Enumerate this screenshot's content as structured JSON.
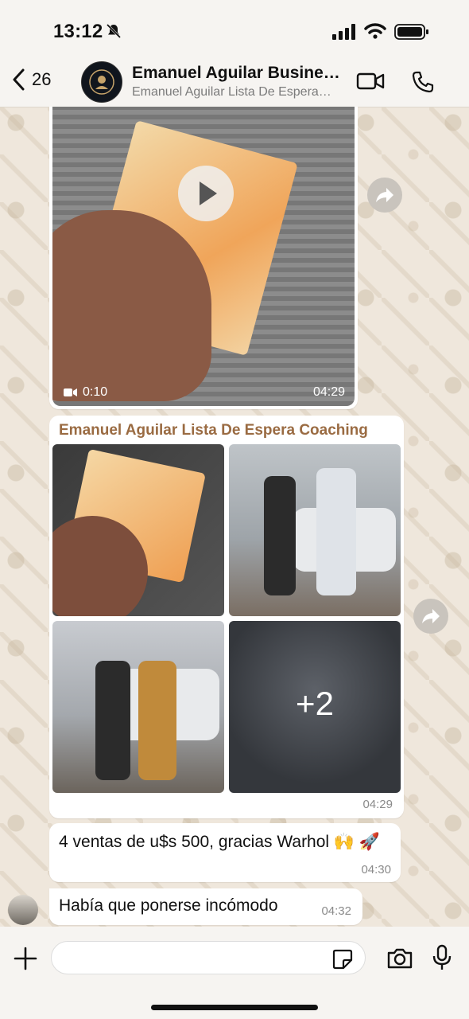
{
  "status_bar": {
    "time": "13:12"
  },
  "header": {
    "back_count": "26",
    "title": "Emanuel Aguilar Busine…",
    "subtitle": "Emanuel Aguilar Lista De Espera…"
  },
  "messages": {
    "video": {
      "duration": "0:10",
      "time": "04:29"
    },
    "album": {
      "sender": "Emanuel Aguilar Lista De Espera Coaching",
      "more_count": "+2",
      "time": "04:29"
    },
    "text": {
      "body": "4 ventas de u$s 500, gracias Warhol 🙌 🚀",
      "time": "04:30"
    },
    "reply": {
      "body": "Había que ponerse incómodo",
      "time": "04:32"
    }
  },
  "composer": {
    "placeholder": ""
  },
  "icons": {
    "back": "chevron-left-icon",
    "video_call": "video-camera-icon",
    "call": "phone-icon",
    "forward": "forward-arrow-icon",
    "attach": "plus-icon",
    "sticker": "sticker-icon",
    "camera": "camera-icon",
    "mic": "microphone-icon"
  }
}
